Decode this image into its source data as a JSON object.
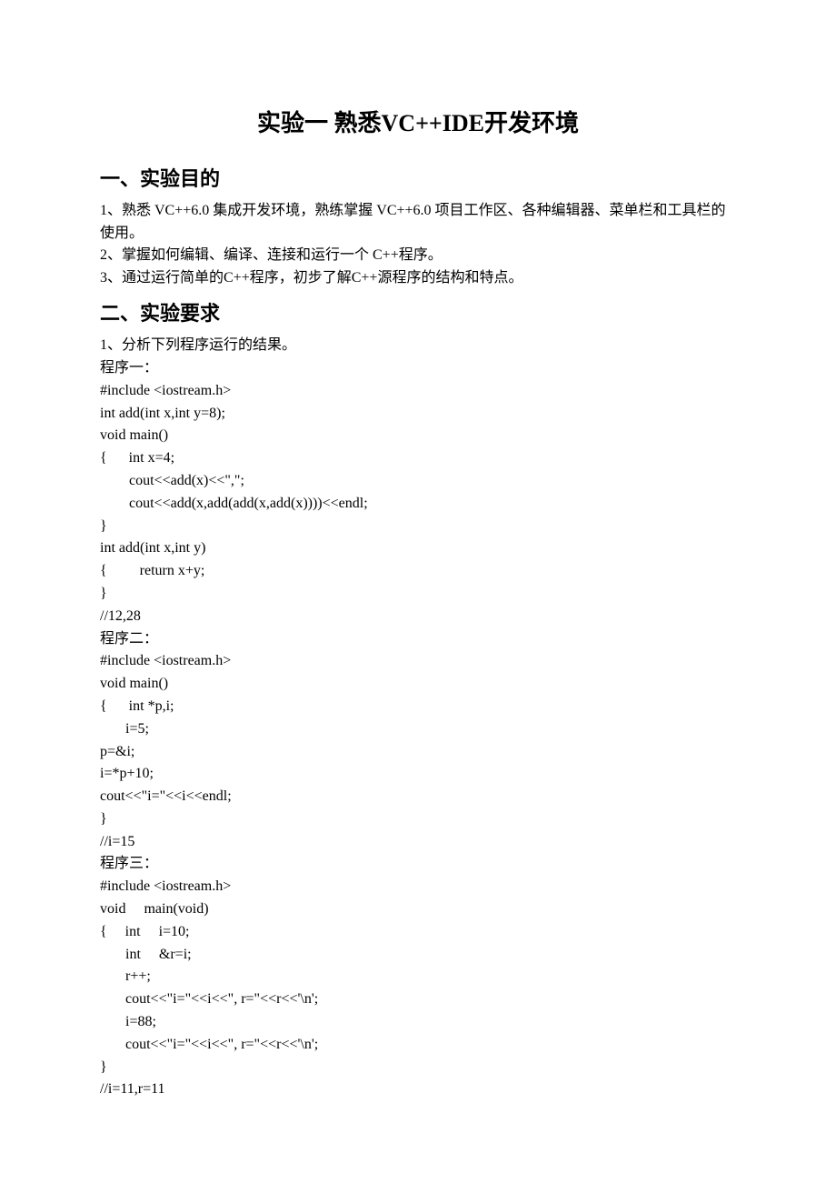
{
  "title": "实验一  熟悉VC++IDE开发环境",
  "section1": {
    "heading": "一、实验目的",
    "p1": "1、熟悉 VC++6.0 集成开发环境，熟练掌握 VC++6.0 项目工作区、各种编辑器、菜单栏和工具栏的使用。",
    "p2": "2、掌握如何编辑、编译、连接和运行一个 C++程序。",
    "p3": "3、通过运行简单的C++程序，初步了解C++源程序的结构和特点。"
  },
  "section2": {
    "heading": "二、实验要求",
    "p1": "1、分析下列程序运行的结果。",
    "prog1_label": "程序一：",
    "prog1": [
      "#include <iostream.h>",
      "int add(int x,int y=8);",
      "void main()",
      "{      int x=4;",
      "        cout<<add(x)<<\",\";",
      "        cout<<add(x,add(add(x,add(x))))<<endl;",
      "}",
      "int add(int x,int y)",
      "{         return x+y;",
      "}",
      "//12,28"
    ],
    "prog2_label": "程序二：",
    "prog2": [
      "#include <iostream.h>",
      "void main()",
      "{      int *p,i;",
      "       i=5;",
      "p=&i;",
      "i=*p+10;",
      "cout<<\"i=\"<<i<<endl;",
      "}",
      "//i=15"
    ],
    "prog3_label": "程序三：",
    "prog3": [
      "#include <iostream.h>",
      "void     main(void)",
      "{     int     i=10;",
      "       int     &r=i;",
      "       r++;",
      "       cout<<\"i=\"<<i<<\", r=\"<<r<<'\\n';",
      "       i=88;",
      "       cout<<\"i=\"<<i<<\", r=\"<<r<<'\\n';",
      "}",
      "//i=11,r=11"
    ]
  }
}
